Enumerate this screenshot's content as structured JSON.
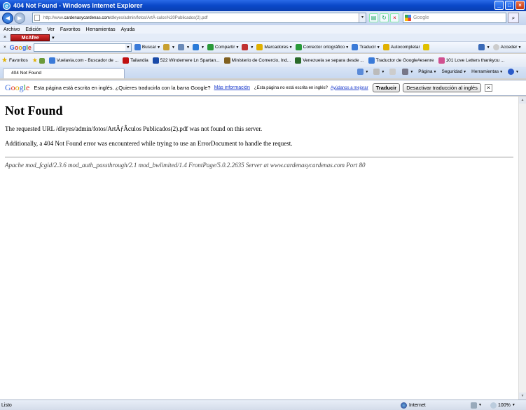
{
  "window": {
    "title": "404 Not Found - Windows Internet Explorer",
    "icon": "ie-icon",
    "buttons": [
      "minimize-icon",
      "maximize-icon",
      "close-icon"
    ]
  },
  "address_bar": {
    "url_prefix": "http://www.",
    "url_host": "cardenasycardenas.com",
    "url_path": "/dleyes/admin/fotos/ArtÃ-culos%20Publicados(2).pdf",
    "search_placeholder": "Google"
  },
  "menu": [
    {
      "label": "Archivo"
    },
    {
      "label": "Edición"
    },
    {
      "label": "Ver"
    },
    {
      "label": "Favoritos"
    },
    {
      "label": "Herramientas"
    },
    {
      "label": "Ayuda"
    }
  ],
  "mcafee": {
    "label": "McAfee"
  },
  "google_toolbar": {
    "logo": "Google",
    "buttons": [
      {
        "label": "Buscar",
        "color": "#3a7ad8"
      },
      {
        "label": "Compartir",
        "color": "#2a9a3a"
      },
      {
        "label": "Marcadores",
        "color": "#e0b000"
      },
      {
        "label": "Corrector ortográfico",
        "color": "#2a9a3a"
      },
      {
        "label": "Traducir",
        "color": "#3a7ad8"
      },
      {
        "label": "Autocompletar",
        "color": "#e0b000"
      }
    ],
    "right": {
      "label": "Acceder"
    }
  },
  "favorites_bar": {
    "label": "Favoritos",
    "items": [
      {
        "label": "Vuelavia.com - Buscador de ...",
        "color": "#3a7ad8"
      },
      {
        "label": "Tailandia",
        "color": "#c01010"
      },
      {
        "label": "522 Windemere Ln Spartan...",
        "color": "#1a4aa8"
      },
      {
        "label": "Ministerio de Comercio, Ind...",
        "color": "#806020"
      },
      {
        "label": "Venezuela se separa desde ...",
        "color": "#2a6a2a"
      },
      {
        "label": "Traductor de Google#esenre",
        "color": "#3a7ad8"
      },
      {
        "label": "101 Love Letters thankyou ...",
        "color": "#d05090"
      }
    ]
  },
  "tab": {
    "title": "404 Not Found"
  },
  "command_bar": [
    {
      "label": "Página"
    },
    {
      "label": "Seguridad"
    },
    {
      "label": "Herramientas"
    }
  ],
  "translate_bar": {
    "logo": "Google",
    "message": "Esta página está escrita en inglés. ¿Quieres traducirla con la barra Google?",
    "more_info": "Más información",
    "question": "¿Esta página no está escrita en inglés?",
    "help_link": "Ayúdanos a mejorar",
    "translate_button": "Traducir",
    "disable_button": "Desactivar traducción al inglés"
  },
  "page": {
    "heading": "Not Found",
    "line1": "The requested URL /dleyes/admin/fotos/ArtÃƒÂ­culos Publicados(2).pdf was not found on this server.",
    "line2": "Additionally, a 404 Not Found error was encountered while trying to use an ErrorDocument to handle the request.",
    "footer": "Apache mod_fcgid/2.3.6 mod_auth_passthrough/2.1 mod_bwlimited/1.4 FrontPage/5.0.2.2635 Server at www.cardenasycardenas.com Port 80"
  },
  "status_bar": {
    "left": "Listo",
    "zone": "Internet",
    "zoom": "100%"
  }
}
